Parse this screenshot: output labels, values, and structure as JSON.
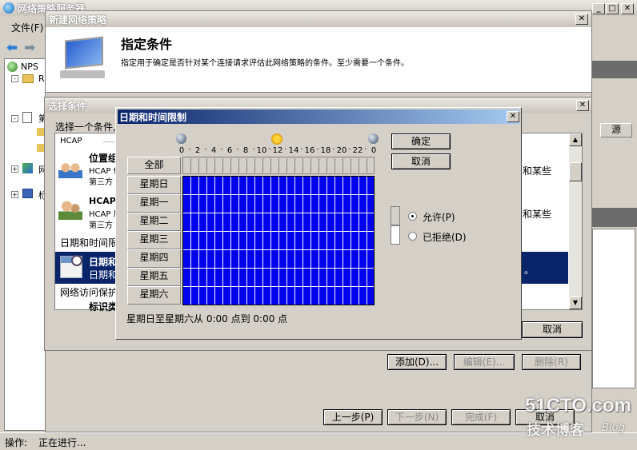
{
  "main_window": {
    "title": "网络策略服务器",
    "menu_file": "文件(F)",
    "status_label": "操作:",
    "status_value": "正在进行..."
  },
  "tree": {
    "nps": "NPS",
    "r": "R",
    "s": "第",
    "n": "网",
    "h": "标"
  },
  "right_column": {
    "header_source": "源"
  },
  "new_policy": {
    "title": "新建网络策略",
    "heading": "指定条件",
    "description": "指定用于确定是否针对某个连接请求评估此网络策略的条件。至少需要一个条件。",
    "add_button": "添加(D)...",
    "edit_button": "编辑(E)...",
    "delete_button": "删除(R)",
    "prev_button": "上一步(P)",
    "next_button": "下一步(N)",
    "finish_button": "完成(F)",
    "cancel_button": "取消"
  },
  "select_condition": {
    "title": "选择条件",
    "prompt": "选择一个条件,",
    "cancel_button": "取消",
    "items": [
      {
        "group": "HCAP"
      },
      {
        "name": "位置组",
        "line1": "HCAP 位",
        "line2": "第三方",
        "right": "和某些"
      },
      {
        "name": "HCAP 用",
        "line1": "HCAP 用",
        "line2": "第三方",
        "right": "和某些"
      },
      {
        "group": "日期和时间限"
      },
      {
        "name": "日期和",
        "line1": "日期和",
        "right": "。"
      },
      {
        "group": "网络访问保护"
      },
      {
        "name": "标识类"
      }
    ]
  },
  "datetime": {
    "title": "日期和时间限制",
    "hours_ticks": [
      "0",
      "2",
      "4",
      "6",
      "8",
      "10",
      "12",
      "14",
      "16",
      "18",
      "20",
      "22",
      "0"
    ],
    "all_label": "全部",
    "days": [
      "星期日",
      "星期一",
      "星期二",
      "星期三",
      "星期四",
      "星期五",
      "星期六"
    ],
    "ok_button": "确定",
    "cancel_button": "取消",
    "permit_label": "允许(P)",
    "deny_label": "已拒绝(D)",
    "permit_selected": true,
    "summary": "星期日至星期六从 0:00 点到 0:00 点",
    "permit_color": "#0000ee",
    "deny_color": "#ffffff"
  },
  "watermark": {
    "domain": "51CTO.com",
    "tagline": "技术博客",
    "blog": "Blog"
  }
}
